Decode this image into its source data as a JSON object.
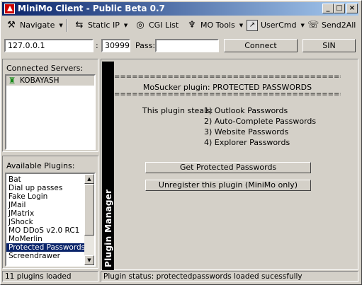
{
  "window": {
    "title": "MiniMo Client - Public Beta 0.7",
    "title_color": "#0a246a"
  },
  "toolbar": {
    "navigate": "Navigate",
    "static_ip": "Static IP",
    "cgi_list": "CGI List",
    "mo_tools": "MO Tools",
    "usercmd": "UserCmd",
    "send2all": "Send2All"
  },
  "connection": {
    "host": "127.0.0.1",
    "colon": ":",
    "port": "30999",
    "pass_label": "Pass:",
    "pass_value": "",
    "connect": "Connect",
    "sin": "SIN"
  },
  "servers": {
    "label": "Connected Servers:",
    "items": [
      "KOBAYASH"
    ]
  },
  "plugins": {
    "label": "Available Plugins:",
    "items": [
      "Bat",
      "Dial up passes",
      "Fake Login",
      "JMail",
      "JMatrix",
      "JShock",
      "MO DDoS v2.0 RC1",
      "MoMerlin",
      "Protected Passwords",
      "Screendrawer"
    ],
    "selected": "Protected Passwords"
  },
  "plugin_manager": {
    "tab_label": "Plugin Manager",
    "rule": "============================================",
    "heading": "MoSucker plugin: PROTECTED PASSWORDS",
    "steals_label": "This plugin steals:",
    "steals": [
      "1) Outlook Passwords",
      "2) Auto-Complete Passwords",
      "3) Website Passwords",
      "4) Explorer Passwords"
    ],
    "get_button": "Get Protected Passwords",
    "unregister_button": "Unregister this plugin (MiniMo only)"
  },
  "status": {
    "left": "11 plugins loaded",
    "right": "Plugin status: protectedpasswords loaded sucessfully"
  }
}
